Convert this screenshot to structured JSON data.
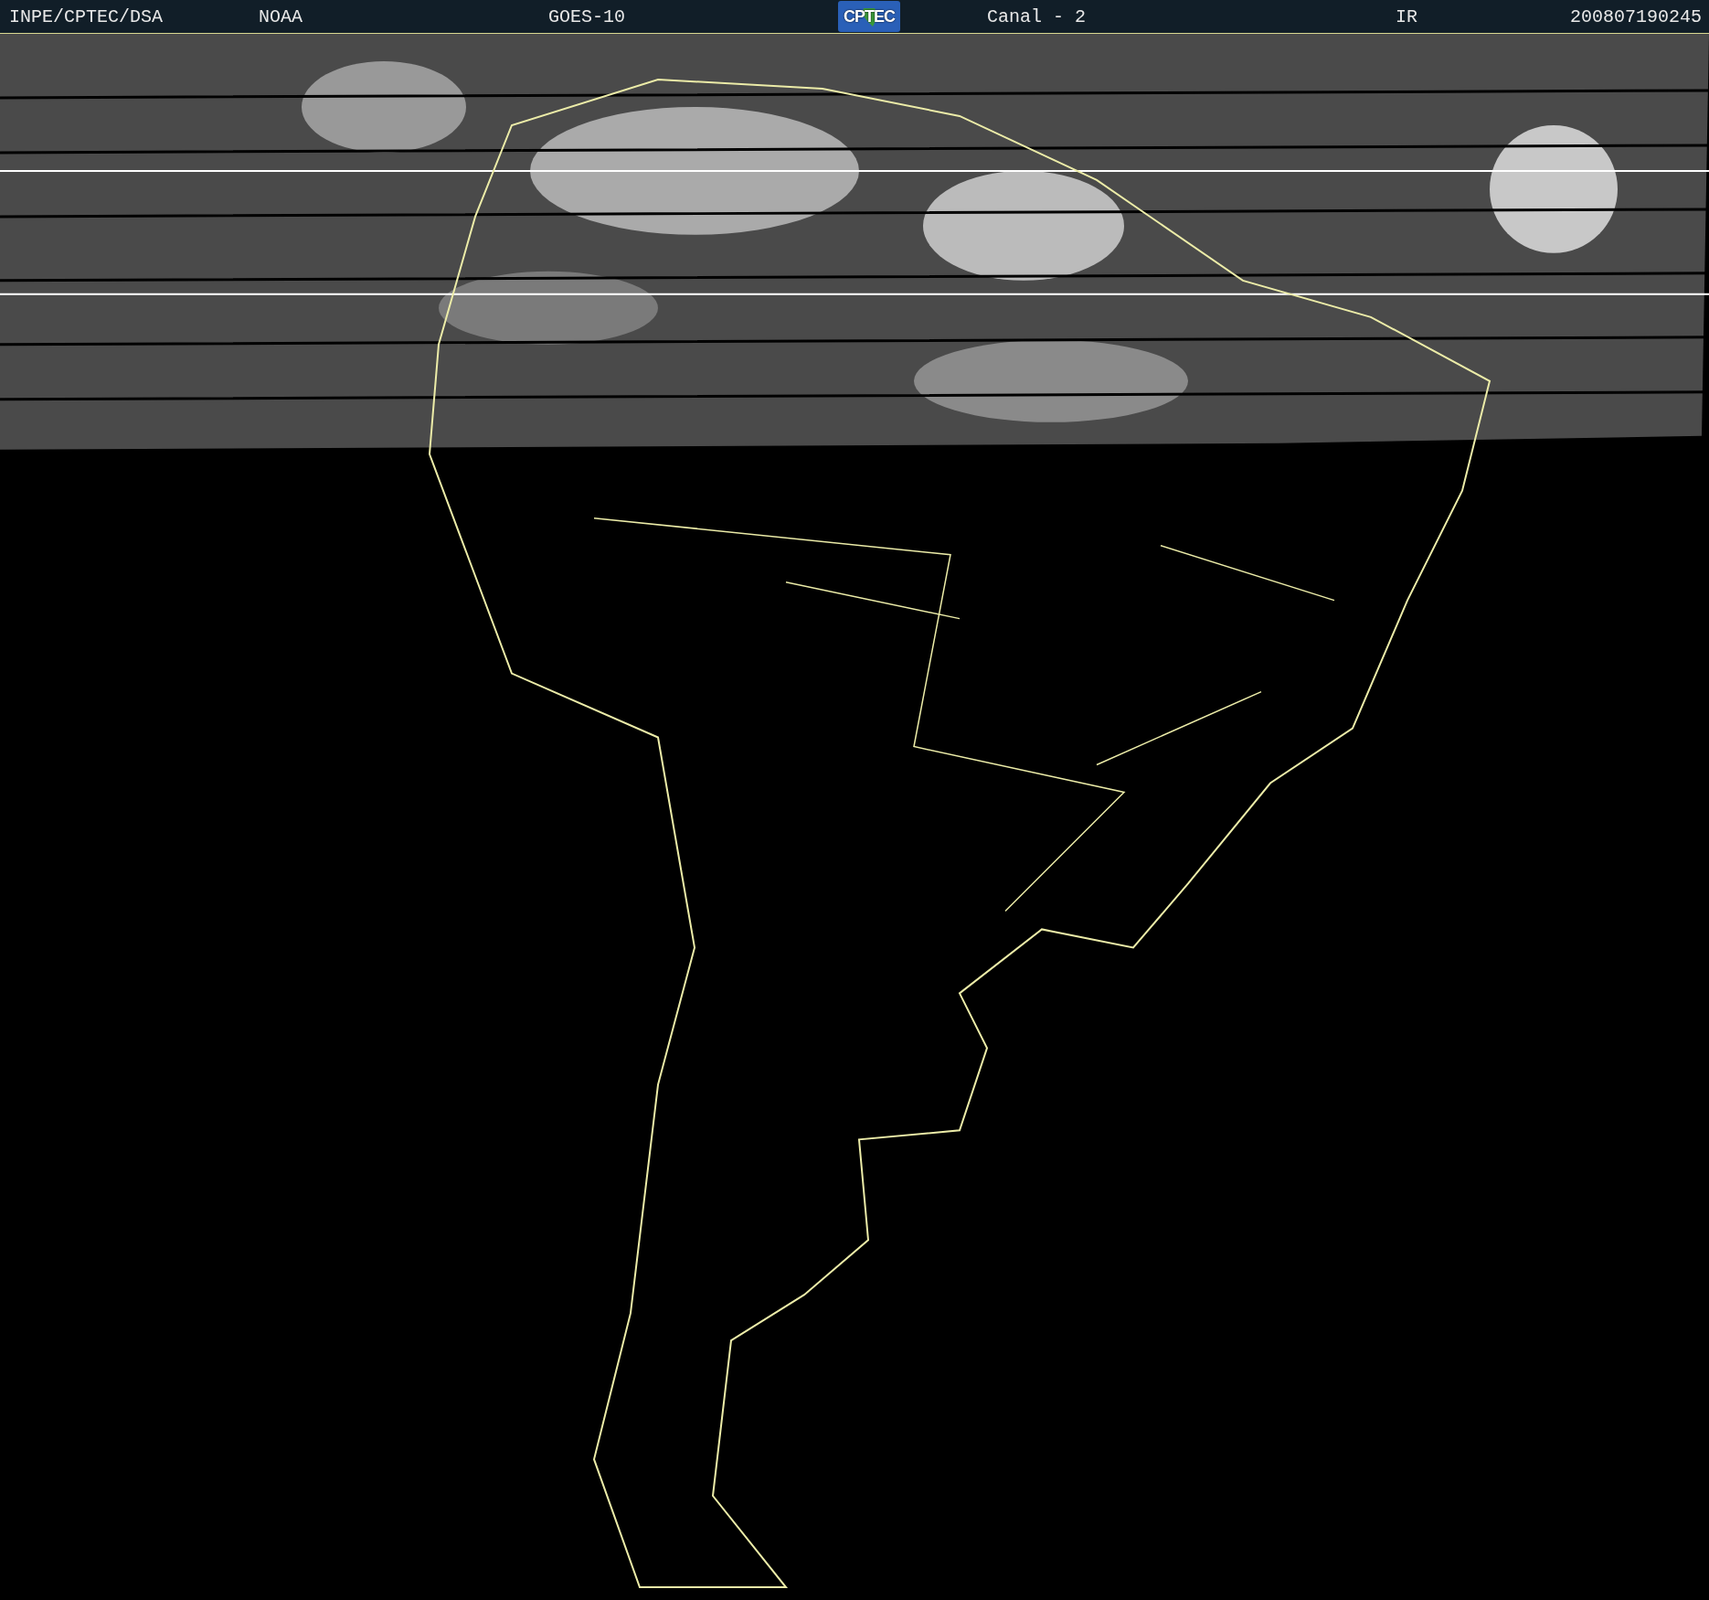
{
  "header": {
    "items": [
      {
        "kind": "text",
        "label": "INPE/CPTEC/DSA"
      },
      {
        "kind": "text",
        "label": "NOAA"
      },
      {
        "kind": "text",
        "label": "GOES-10"
      },
      {
        "kind": "logo",
        "label": "CPTEC"
      },
      {
        "kind": "text",
        "label": "Canal - 2"
      },
      {
        "kind": "text",
        "label": "IR"
      },
      {
        "kind": "text",
        "label": "200807190245"
      }
    ]
  }
}
